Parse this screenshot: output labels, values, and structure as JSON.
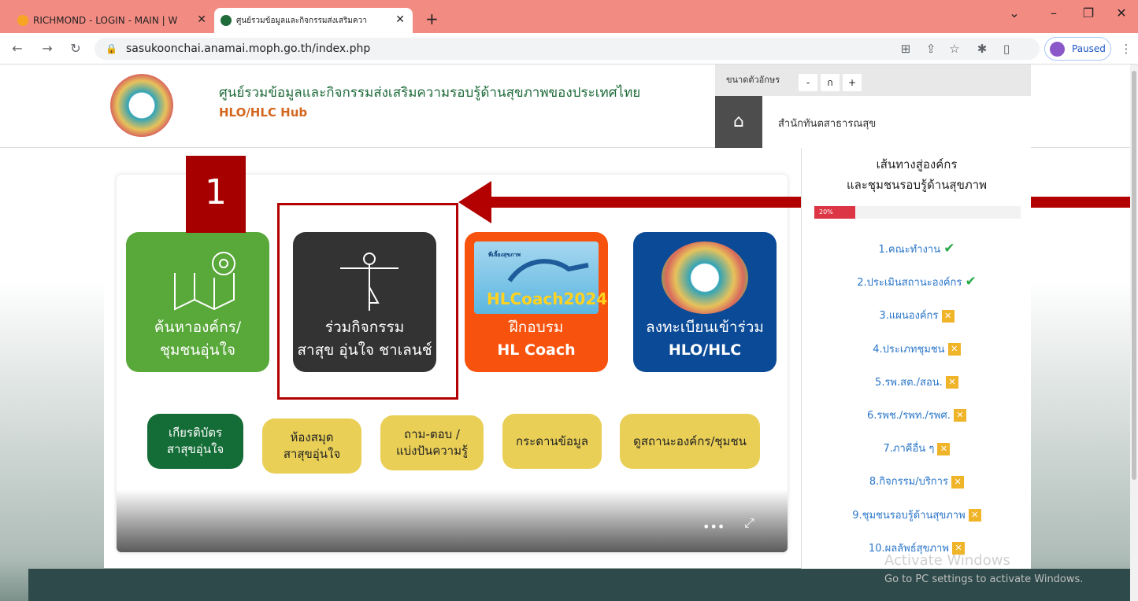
{
  "browser": {
    "tabs": [
      {
        "label": "RICHMOND - LOGIN - MAIN | W",
        "active": false
      },
      {
        "label": "ศูนย์รวมข้อมูลและกิจกรรมส่งเสริมควา",
        "active": true
      }
    ],
    "new_tab": "+",
    "url": "sasukoonchai.anamai.moph.go.th/index.php",
    "profile_status": "Paused"
  },
  "header": {
    "title": "ศูนย์รวมข้อมูลและกิจกรรมส่งเสริมความรอบรู้ด้านสุขภาพของประเทศไทย",
    "subtitle": "HLO/HLC Hub",
    "font_size_label": "ขนาดตัวอักษร",
    "font_buttons": [
      "-",
      "ก",
      "+"
    ],
    "home_label": "สำนักทันตสาธารณสุข"
  },
  "tiles": [
    {
      "line1": "ค้นหาองค์กร/",
      "line2": "ชุมชนอุ่นใจ",
      "icon": "map-pin-icon",
      "color": "#58a83a"
    },
    {
      "line1": "ร่วมกิจกรรม",
      "line2": "สาสุข อุ่นใจ ชาเลนช์",
      "icon": "yoga-pose-icon",
      "color": "#333333"
    },
    {
      "line1": "ฝึกอบรม",
      "line2": "HL Coach",
      "icon": "handshake-icon",
      "color": "#f7530f",
      "banner_small": "พี่เลี้ยงสุขภาพ",
      "banner": "HLCoach2024"
    },
    {
      "line1": "ลงทะเบียนเข้าร่วม",
      "line2": "HLO/HLC",
      "icon": "logo-icon",
      "color": "#0a4a96"
    }
  ],
  "pills": [
    {
      "line1": "เกียรติบัตร",
      "line2": "สาสุขอุ่นใจ",
      "color": "#146c36"
    },
    {
      "line1": "ห้องสมุด",
      "line2": "สาสุขอุ่นใจ",
      "color": "#e9cf56"
    },
    {
      "line1": "ถาม-ตอบ /",
      "line2": "แบ่งปันความรู้",
      "color": "#e9cf56"
    },
    {
      "line1": "กระดานข้อมูล",
      "line2": "",
      "color": "#e9cf56"
    },
    {
      "line1": "ดูสถานะองค์กร/ชุมชน",
      "line2": "",
      "color": "#e9cf56"
    }
  ],
  "annotation": {
    "number": "1"
  },
  "video_controls": {
    "more": "•••",
    "fullscreen": "⤢"
  },
  "sidebar": {
    "title_line1": "เส้นทางสู่องค์กร",
    "title_line2": "และชุมชนรอบรู้ด้านสุขภาพ",
    "progress_label": "20%",
    "progress_value": 0.2,
    "steps": [
      {
        "label": "1.คณะทำงาน",
        "done": true
      },
      {
        "label": "2.ประเมินสถานะองค์กร",
        "done": true
      },
      {
        "label": "3.แผนองค์กร",
        "done": false
      },
      {
        "label": "4.ประเภทชุมชน",
        "done": false
      },
      {
        "label": "5.รพ.สต./สอน.",
        "done": false
      },
      {
        "label": "6.รพช./รพท./รพศ.",
        "done": false
      },
      {
        "label": "7.ภาคีอื่น ๆ",
        "done": false
      },
      {
        "label": "8.กิจกรรม/บริการ",
        "done": false
      },
      {
        "label": "9.ชุมชนรอบรู้ด้านสุขภาพ",
        "done": false
      },
      {
        "label": "10.ผลลัพธ์สุขภาพ",
        "done": false
      }
    ]
  },
  "watermark": {
    "line1": "Activate Windows",
    "line2": "Go to PC settings to activate Windows."
  }
}
